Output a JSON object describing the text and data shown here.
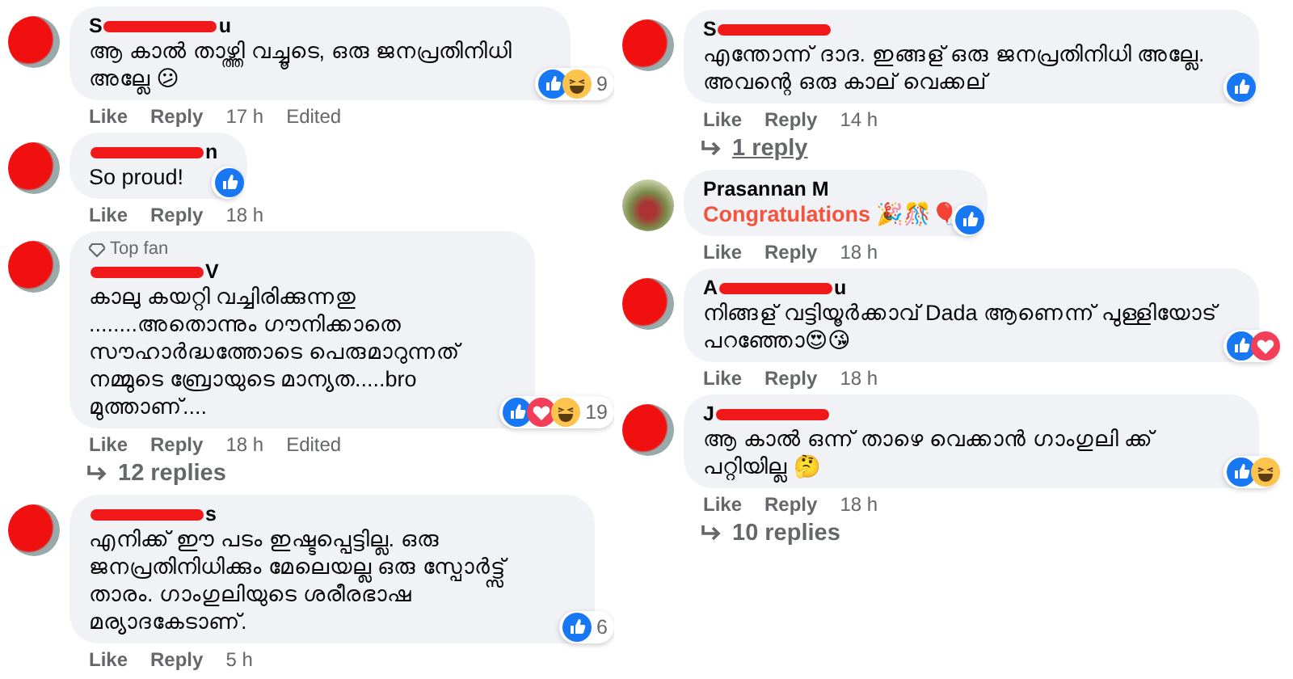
{
  "left_column": {
    "comments": [
      {
        "avatar_redacted": true,
        "name_start": "S",
        "name_redacted": true,
        "name_end": "u",
        "text": "ആ കാൽ താഴ്ത്തി വച്ചൂടെ, ഒരു ജനപ്രതിനിധി അല്ലേ 😕",
        "highlighted": false,
        "actions": [
          "Like",
          "Reply"
        ],
        "time": "17 h",
        "edited": "Edited",
        "reactions": [
          {
            "kind": "like"
          },
          {
            "kind": "haha"
          }
        ],
        "reaction_count": "9"
      },
      {
        "avatar_redacted": true,
        "name_redacted": true,
        "name_end": "n",
        "text": "So proud!",
        "highlighted": false,
        "actions": [
          "Like",
          "Reply"
        ],
        "time": "18 h",
        "reactions": [
          {
            "kind": "like"
          }
        ]
      },
      {
        "avatar_redacted": true,
        "badge": "Top fan",
        "name_redacted": true,
        "name_end": "V",
        "text": "കാലു കയറ്റി വച്ചിരിക്കുന്നതു ........അതൊന്നും ഗൗനിക്കാതെ സൗഹാർദ്ധത്തോടെ പെരുമാറുന്നത് നമ്മുടെ ബ്രോയുടെ മാന്യത.....bro മുത്താണ്....",
        "highlighted": false,
        "actions": [
          "Like",
          "Reply"
        ],
        "time": "18 h",
        "edited": "Edited",
        "reactions": [
          {
            "kind": "like"
          },
          {
            "kind": "love"
          },
          {
            "kind": "haha"
          }
        ],
        "reaction_count": "19",
        "replies": {
          "label": "12 replies",
          "underlined": false
        }
      },
      {
        "avatar_redacted": true,
        "name_redacted": true,
        "name_end": "s",
        "text": "എനിക്ക് ഈ പടം ഇഷ്ടപ്പെട്ടില്ല. ഒരു ജനപ്രതിനിധിക്കും മേലെയല്ല ഒരു സ്പോർട്ട്സ് താരം. ഗാംഗുലിയുടെ ശരീരഭാഷ മര്യാദകേടാണ്.",
        "highlighted": false,
        "actions": [
          "Like",
          "Reply"
        ],
        "time": "5 h",
        "reactions": [
          {
            "kind": "like"
          }
        ],
        "reaction_count": "6"
      }
    ]
  },
  "right_column": {
    "comments": [
      {
        "avatar_redacted": true,
        "name_start": "S",
        "name_redacted": true,
        "text": "എന്തോന്ന് ദാദ. ഇങ്ങള് ഒരു ജനപ്രതിനിധി അല്ലേ. അവന്റെ ഒരു കാല് വെക്കല്",
        "highlighted": false,
        "actions": [
          "Like",
          "Reply"
        ],
        "time": "14 h",
        "reactions": [
          {
            "kind": "like"
          }
        ],
        "replies": {
          "label": "1 reply",
          "underlined": true
        }
      },
      {
        "avatar_redacted": false,
        "name_start": "Prasannan M",
        "name_redacted": false,
        "text": "Congratulations 🎉🎊🎈",
        "highlighted": true,
        "actions": [
          "Like",
          "Reply"
        ],
        "time": "18 h",
        "reactions": [
          {
            "kind": "like"
          }
        ]
      },
      {
        "avatar_redacted": true,
        "name_start": "A",
        "name_redacted": true,
        "name_end": "u",
        "text": "നിങ്ങള് വട്ടിയൂർക്കാവ് Dada ആണെന്ന് പുള്ളിയോട് പറഞ്ഞോ😍😘",
        "highlighted": false,
        "actions": [
          "Like",
          "Reply"
        ],
        "time": "18 h",
        "reactions": [
          {
            "kind": "like"
          },
          {
            "kind": "love"
          }
        ]
      },
      {
        "avatar_redacted": true,
        "name_start": "J",
        "name_redacted": true,
        "text": "ആ കാൽ ഒന്ന് താഴെ വെക്കാൻ ഗാംഗുലി ക്ക് പറ്റിയില്ല 🤔",
        "highlighted": false,
        "actions": [
          "Like",
          "Reply"
        ],
        "time": "18 h",
        "reactions": [
          {
            "kind": "like"
          },
          {
            "kind": "haha"
          }
        ],
        "replies": {
          "label": "10 replies",
          "underlined": false
        }
      }
    ]
  }
}
